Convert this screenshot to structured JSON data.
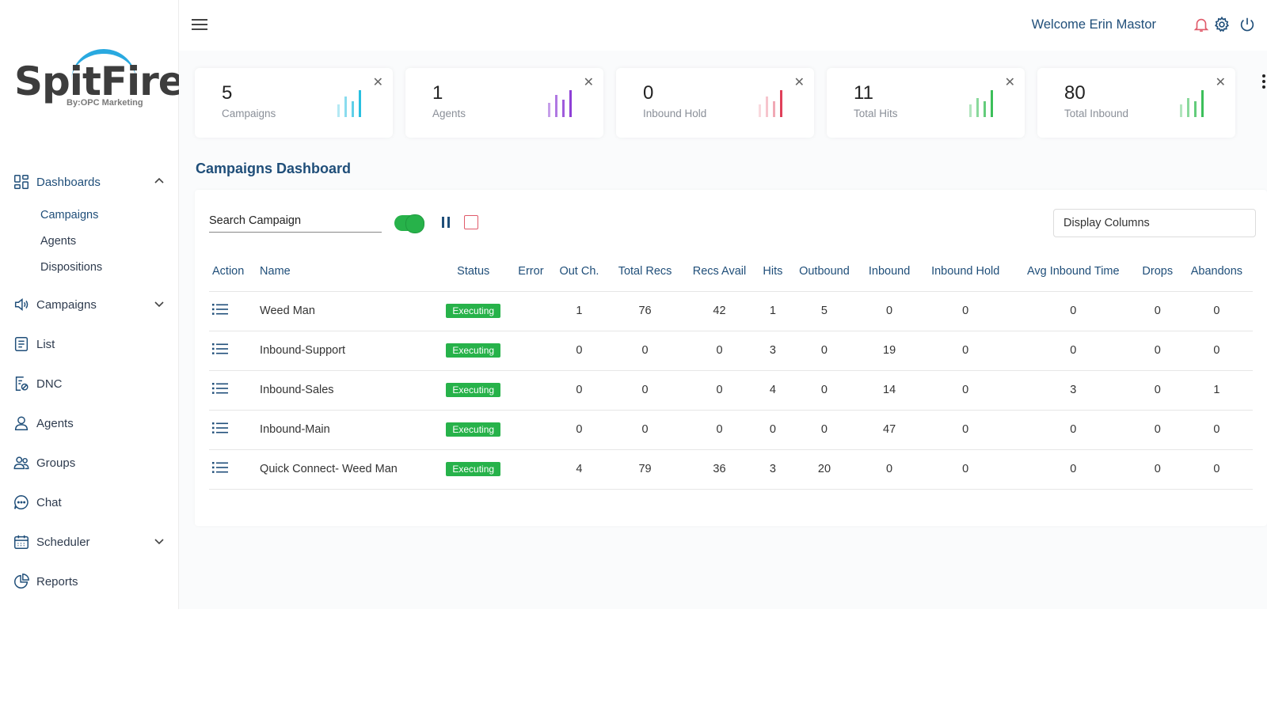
{
  "app": {
    "logo_text": "SpitFire",
    "logo_sub": "By:OPC Marketing",
    "welcome": "Welcome Erin Mastor"
  },
  "sidebar": {
    "items": [
      {
        "label": "Dashboards",
        "icon": "dashboard-icon",
        "expanded": true
      },
      {
        "label": "Campaigns",
        "icon": "speaker-icon"
      },
      {
        "label": "List",
        "icon": "list-icon"
      },
      {
        "label": "DNC",
        "icon": "dnc-icon"
      },
      {
        "label": "Agents",
        "icon": "user-icon"
      },
      {
        "label": "Groups",
        "icon": "group-icon"
      },
      {
        "label": "Chat",
        "icon": "chat-icon"
      },
      {
        "label": "Scheduler",
        "icon": "calendar-icon"
      },
      {
        "label": "Reports",
        "icon": "pie-chart-icon"
      }
    ],
    "sub_items": [
      "Campaigns",
      "Agents",
      "Dispositions"
    ]
  },
  "cards": [
    {
      "value": "5",
      "label": "Campaigns",
      "color": "#29c0e0"
    },
    {
      "value": "1",
      "label": "Agents",
      "color": "#8e3fd6"
    },
    {
      "value": "0",
      "label": "Inbound Hold",
      "color": "#e0405a"
    },
    {
      "value": "11",
      "label": "Total Hits",
      "color": "#3cbf5a"
    },
    {
      "value": "80",
      "label": "Total Inbound",
      "color": "#3cbf5a"
    }
  ],
  "dashboard": {
    "title": "Campaigns Dashboard",
    "search_placeholder": "Search Campaign",
    "display_columns": "Display Columns"
  },
  "table": {
    "columns": [
      "Action",
      "Name",
      "Status",
      "Error",
      "Out Ch.",
      "Total Recs",
      "Recs Avail",
      "Hits",
      "Outbound",
      "Inbound",
      "Inbound Hold",
      "Avg Inbound Time",
      "Drops",
      "Abandons"
    ],
    "rows": [
      {
        "name": "Weed Man",
        "status": "Executing",
        "error": "",
        "out_ch": "1",
        "total_recs": "76",
        "recs_avail": "42",
        "hits": "1",
        "outbound": "5",
        "inbound": "0",
        "inbound_hold": "0",
        "avg_inbound_time": "0",
        "drops": "0",
        "abandons": "0"
      },
      {
        "name": "Inbound-Support",
        "status": "Executing",
        "error": "",
        "out_ch": "0",
        "total_recs": "0",
        "recs_avail": "0",
        "hits": "3",
        "outbound": "0",
        "inbound": "19",
        "inbound_hold": "0",
        "avg_inbound_time": "0",
        "drops": "0",
        "abandons": "0"
      },
      {
        "name": "Inbound-Sales",
        "status": "Executing",
        "error": "",
        "out_ch": "0",
        "total_recs": "0",
        "recs_avail": "0",
        "hits": "4",
        "outbound": "0",
        "inbound": "14",
        "inbound_hold": "0",
        "avg_inbound_time": "3",
        "drops": "0",
        "abandons": "1"
      },
      {
        "name": "Inbound-Main",
        "status": "Executing",
        "error": "",
        "out_ch": "0",
        "total_recs": "0",
        "recs_avail": "0",
        "hits": "0",
        "outbound": "0",
        "inbound": "47",
        "inbound_hold": "0",
        "avg_inbound_time": "0",
        "drops": "0",
        "abandons": "0"
      },
      {
        "name": "Quick Connect- Weed Man",
        "status": "Executing",
        "error": "",
        "out_ch": "4",
        "total_recs": "79",
        "recs_avail": "36",
        "hits": "3",
        "outbound": "20",
        "inbound": "0",
        "inbound_hold": "0",
        "avg_inbound_time": "0",
        "drops": "0",
        "abandons": "0"
      }
    ]
  },
  "colors": {
    "accent": "#1f4e79",
    "success": "#27b24a",
    "alert": "#e05a6a"
  }
}
